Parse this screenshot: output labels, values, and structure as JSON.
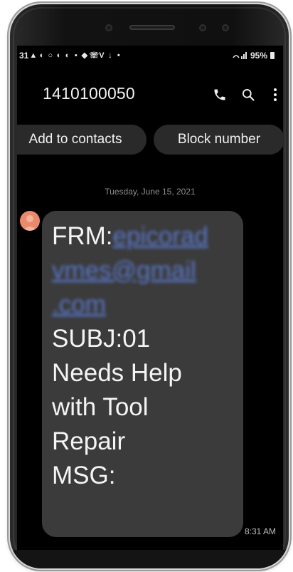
{
  "status_bar": {
    "time": "31",
    "left_icons": [
      "warning-icon",
      "notification-icon",
      "circle-icon",
      "notification-icon",
      "notification-icon",
      "message-icon",
      "shield-icon",
      "wifi-calling-icon",
      "v-icon",
      "download-icon",
      "dot-icon"
    ],
    "signal_icon": "signal-icon",
    "battery_percent": "95%",
    "battery_icon": "battery-icon"
  },
  "app_bar": {
    "contact_number": "1410100050",
    "actions": [
      {
        "name": "call-icon"
      },
      {
        "name": "search-icon"
      },
      {
        "name": "more-icon"
      }
    ]
  },
  "actions": {
    "add_to_contacts": "Add to contacts",
    "block_number": "Block number"
  },
  "conversation": {
    "date": "Tuesday, June 15, 2021",
    "message": {
      "lines": [
        {
          "prefix": "FRM:",
          "link": "epicorad"
        },
        {
          "prefix": "",
          "link": "vmes@gmail"
        },
        {
          "prefix": "",
          "link": ".com"
        },
        {
          "prefix": "SUBJ:01",
          "link": ""
        },
        {
          "prefix": "Needs Help",
          "link": ""
        },
        {
          "prefix": "with Tool",
          "link": ""
        },
        {
          "prefix": "Repair",
          "link": ""
        },
        {
          "prefix": "MSG:",
          "link": ""
        }
      ],
      "timestamp": "8:31 AM"
    }
  },
  "colors": {
    "screen_bg": "#000000",
    "bubble_bg": "#3b3b3b",
    "chip_bg": "#2a2a2a",
    "link": "#5a77c9",
    "avatar": "#e98a6b"
  }
}
